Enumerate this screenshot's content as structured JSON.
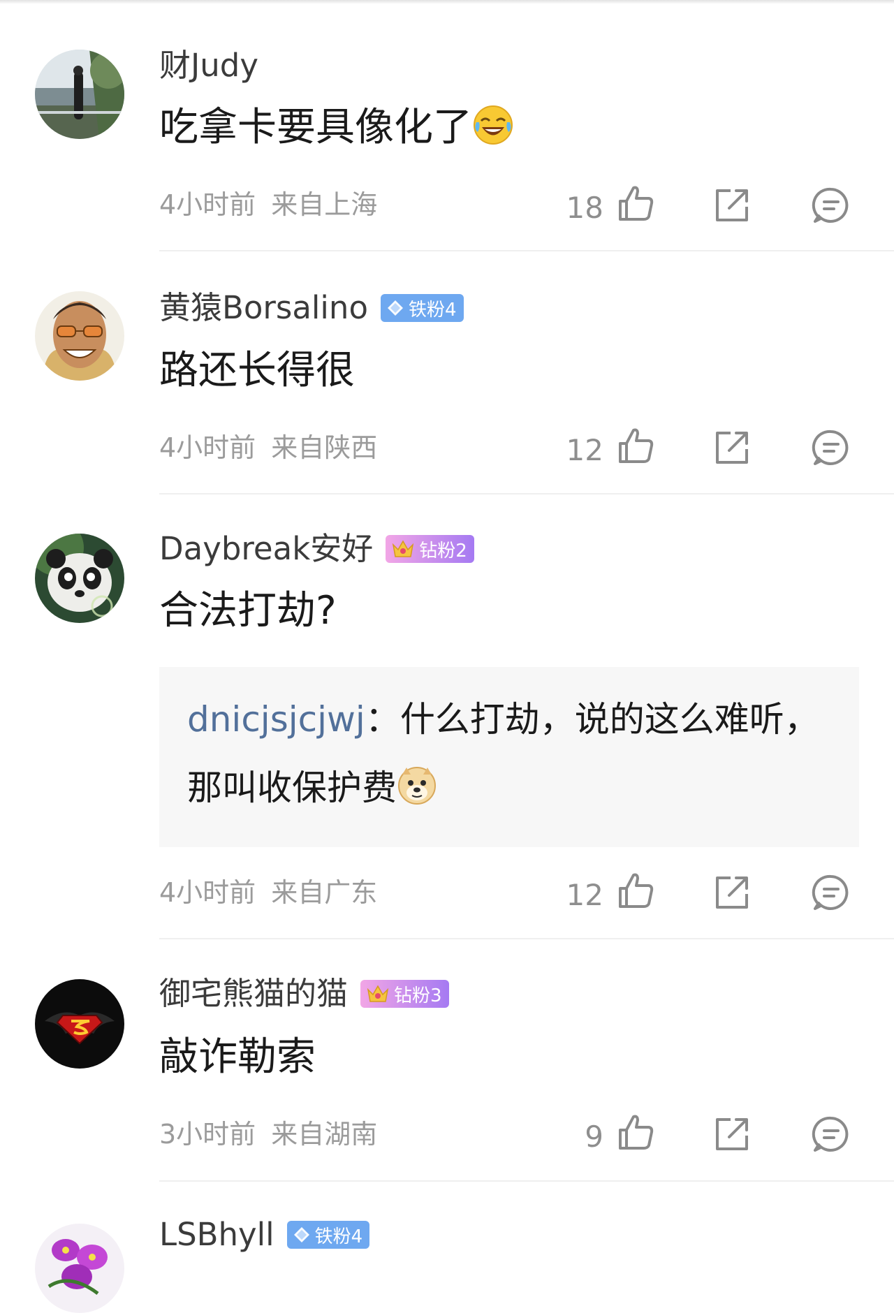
{
  "comments": [
    {
      "username": "财Judy",
      "badge": null,
      "content": "吃拿卡要具像化了",
      "content_emoji": "laugh-cry-emoji",
      "time": "4小时前",
      "location": "来自上海",
      "likes": "18"
    },
    {
      "username": "黄猿Borsalino",
      "badge": {
        "type": "iron",
        "label": "铁粉4"
      },
      "content": "路还长得很",
      "time": "4小时前",
      "location": "来自陕西",
      "likes": "12"
    },
    {
      "username": "Daybreak安好",
      "badge": {
        "type": "diamond",
        "label": "钻粉2"
      },
      "content": "合法打劫?",
      "reply": {
        "username": "dnicjsjcjwj",
        "separator": "：",
        "text": "什么打劫，说的这么难听，那叫收保护费",
        "emoji": "doge-emoji"
      },
      "time": "4小时前",
      "location": "来自广东",
      "likes": "12"
    },
    {
      "username": "御宅熊猫的猫",
      "badge": {
        "type": "diamond",
        "label": "钻粉3"
      },
      "content": "敲诈勒索",
      "time": "3小时前",
      "location": "来自湖南",
      "likes": "9"
    },
    {
      "username": "LSBhyll",
      "badge": {
        "type": "iron",
        "label": "铁粉4"
      },
      "content": "",
      "time": "",
      "location": "",
      "likes": ""
    }
  ],
  "colors": {
    "username": "#3b3b3b",
    "meta": "#9b9b9b",
    "reply_user": "#52709a",
    "reply_bg": "#f7f7f7",
    "iron_badge": "#6ea8f0",
    "icon_gray": "#8a8a8a"
  }
}
